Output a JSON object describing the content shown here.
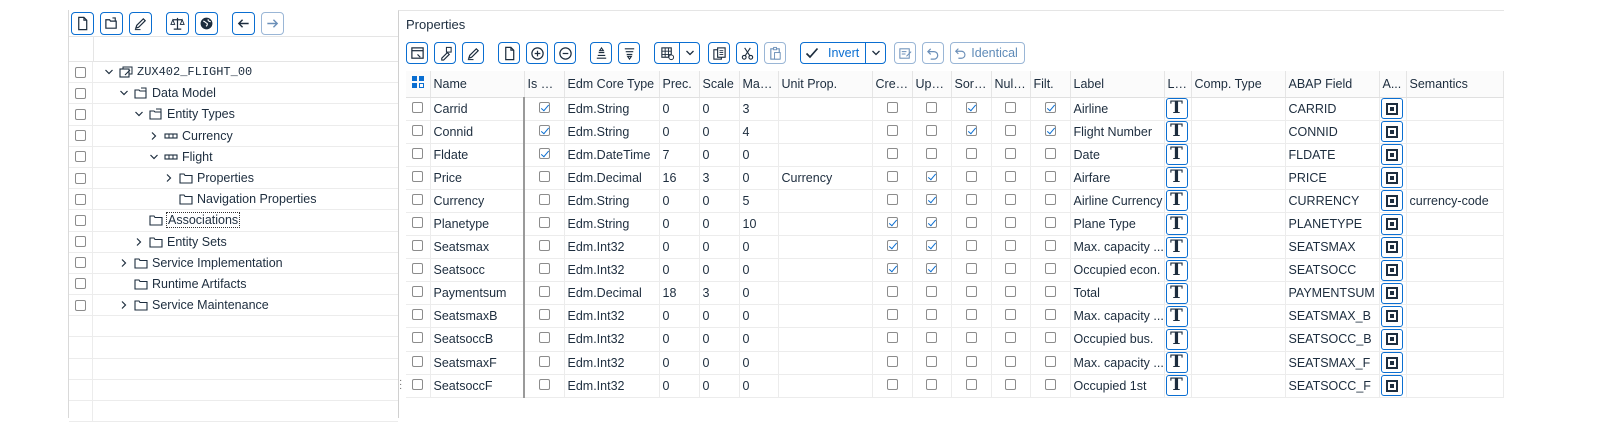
{
  "tree": {
    "rows": [
      {
        "label": "ZUX402_FLIGHT_00",
        "level": 0,
        "expander": "expanded",
        "icon": "service-project-icon",
        "mono": true
      },
      {
        "label": "Data Model",
        "level": 1,
        "expander": "expanded",
        "icon": "model-folder-icon"
      },
      {
        "label": "Entity Types",
        "level": 2,
        "expander": "expanded",
        "icon": "model-folder-icon"
      },
      {
        "label": "Currency",
        "level": 3,
        "expander": "collapsed",
        "icon": "entity-type-icon"
      },
      {
        "label": "Flight",
        "level": 3,
        "expander": "expanded",
        "icon": "entity-type-icon"
      },
      {
        "label": "Properties",
        "level": 4,
        "expander": "collapsed",
        "icon": "folder-icon"
      },
      {
        "label": "Navigation Properties",
        "level": 4,
        "expander": "none",
        "icon": "folder-icon"
      },
      {
        "label": "Associations",
        "level": 2,
        "expander": "none",
        "icon": "folder-icon",
        "focused": true
      },
      {
        "label": "Entity Sets",
        "level": 2,
        "expander": "collapsed",
        "icon": "folder-icon"
      },
      {
        "label": "Service Implementation",
        "level": 1,
        "expander": "collapsed",
        "icon": "folder-icon"
      },
      {
        "label": "Runtime Artifacts",
        "level": 1,
        "expander": "none",
        "icon": "folder-icon"
      },
      {
        "label": "Service Maintenance",
        "level": 1,
        "expander": "collapsed",
        "icon": "folder-icon"
      }
    ],
    "toolbar_icons": [
      "new-document-icon",
      "open-folder-icon",
      "edit-pencil-icon",
      "balance-scale-icon",
      "globe-icon",
      "arrow-left-icon",
      "arrow-right-icon"
    ]
  },
  "properties": {
    "title": "Properties",
    "toolbar": {
      "invert_label": "Invert",
      "identical_label": "Identical"
    },
    "columns": [
      "Name",
      "Is Key",
      "Edm Core Type",
      "Prec.",
      "Scale",
      "Max ...",
      "Unit Prop.",
      "Crea...",
      "Upda...",
      "Sorta...",
      "Nulla...",
      "Filt.",
      "Label",
      "La...",
      "Comp. Type",
      "ABAP Field",
      "A...",
      "Semantics"
    ],
    "rows": [
      {
        "name": "Carrid",
        "key": true,
        "type": "Edm.String",
        "prec": "0",
        "scale": "0",
        "max": "3",
        "unit": "",
        "crea": false,
        "upda": false,
        "sort": true,
        "null": false,
        "filt": true,
        "label": "Airline",
        "comp": "",
        "abap": "CARRID",
        "sem": ""
      },
      {
        "name": "Connid",
        "key": true,
        "type": "Edm.String",
        "prec": "0",
        "scale": "0",
        "max": "4",
        "unit": "",
        "crea": false,
        "upda": false,
        "sort": true,
        "null": false,
        "filt": true,
        "label": "Flight Number",
        "comp": "",
        "abap": "CONNID",
        "sem": ""
      },
      {
        "name": "Fldate",
        "key": true,
        "type": "Edm.DateTime",
        "prec": "7",
        "scale": "0",
        "max": "0",
        "unit": "",
        "crea": false,
        "upda": false,
        "sort": false,
        "null": false,
        "filt": false,
        "label": "Date",
        "comp": "",
        "abap": "FLDATE",
        "sem": ""
      },
      {
        "name": "Price",
        "key": false,
        "type": "Edm.Decimal",
        "prec": "16",
        "scale": "3",
        "max": "0",
        "unit": "Currency",
        "crea": false,
        "upda": true,
        "sort": false,
        "null": false,
        "filt": false,
        "label": "Airfare",
        "comp": "",
        "abap": "PRICE",
        "sem": ""
      },
      {
        "name": "Currency",
        "key": false,
        "type": "Edm.String",
        "prec": "0",
        "scale": "0",
        "max": "5",
        "unit": "",
        "crea": false,
        "upda": true,
        "sort": false,
        "null": false,
        "filt": false,
        "label": "Airline Currency",
        "comp": "",
        "abap": "CURRENCY",
        "sem": "currency-code"
      },
      {
        "name": "Planetype",
        "key": false,
        "type": "Edm.String",
        "prec": "0",
        "scale": "0",
        "max": "10",
        "unit": "",
        "crea": true,
        "upda": true,
        "sort": false,
        "null": false,
        "filt": false,
        "label": "Plane Type",
        "comp": "",
        "abap": "PLANETYPE",
        "sem": ""
      },
      {
        "name": "Seatsmax",
        "key": false,
        "type": "Edm.Int32",
        "prec": "0",
        "scale": "0",
        "max": "0",
        "unit": "",
        "crea": true,
        "upda": true,
        "sort": false,
        "null": false,
        "filt": false,
        "label": "Max. capacity ...",
        "comp": "",
        "abap": "SEATSMAX",
        "sem": ""
      },
      {
        "name": "Seatsocc",
        "key": false,
        "type": "Edm.Int32",
        "prec": "0",
        "scale": "0",
        "max": "0",
        "unit": "",
        "crea": true,
        "upda": true,
        "sort": false,
        "null": false,
        "filt": false,
        "label": "Occupied econ.",
        "comp": "",
        "abap": "SEATSOCC",
        "sem": ""
      },
      {
        "name": "Paymentsum",
        "key": false,
        "type": "Edm.Decimal",
        "prec": "18",
        "scale": "3",
        "max": "0",
        "unit": "",
        "crea": false,
        "upda": false,
        "sort": false,
        "null": false,
        "filt": false,
        "label": "Total",
        "comp": "",
        "abap": "PAYMENTSUM",
        "sem": ""
      },
      {
        "name": "SeatsmaxB",
        "key": false,
        "type": "Edm.Int32",
        "prec": "0",
        "scale": "0",
        "max": "0",
        "unit": "",
        "crea": false,
        "upda": false,
        "sort": false,
        "null": false,
        "filt": false,
        "label": "Max. capacity ...",
        "comp": "",
        "abap": "SEATSMAX_B",
        "sem": ""
      },
      {
        "name": "SeatsoccB",
        "key": false,
        "type": "Edm.Int32",
        "prec": "0",
        "scale": "0",
        "max": "0",
        "unit": "",
        "crea": false,
        "upda": false,
        "sort": false,
        "null": false,
        "filt": false,
        "label": "Occupied bus.",
        "comp": "",
        "abap": "SEATSOCC_B",
        "sem": ""
      },
      {
        "name": "SeatsmaxF",
        "key": false,
        "type": "Edm.Int32",
        "prec": "0",
        "scale": "0",
        "max": "0",
        "unit": "",
        "crea": false,
        "upda": false,
        "sort": false,
        "null": false,
        "filt": false,
        "label": "Max. capacity ...",
        "comp": "",
        "abap": "SEATSMAX_F",
        "sem": ""
      },
      {
        "name": "SeatsoccF",
        "key": false,
        "type": "Edm.Int32",
        "prec": "0",
        "scale": "0",
        "max": "0",
        "unit": "",
        "crea": false,
        "upda": false,
        "sort": false,
        "null": false,
        "filt": false,
        "label": "Occupied 1st",
        "comp": "",
        "abap": "SEATSOCC_F",
        "sem": ""
      }
    ]
  },
  "colors": {
    "accent": "#0a6ed1",
    "text": "#1d2d3e",
    "border": "#e5e5e5"
  }
}
